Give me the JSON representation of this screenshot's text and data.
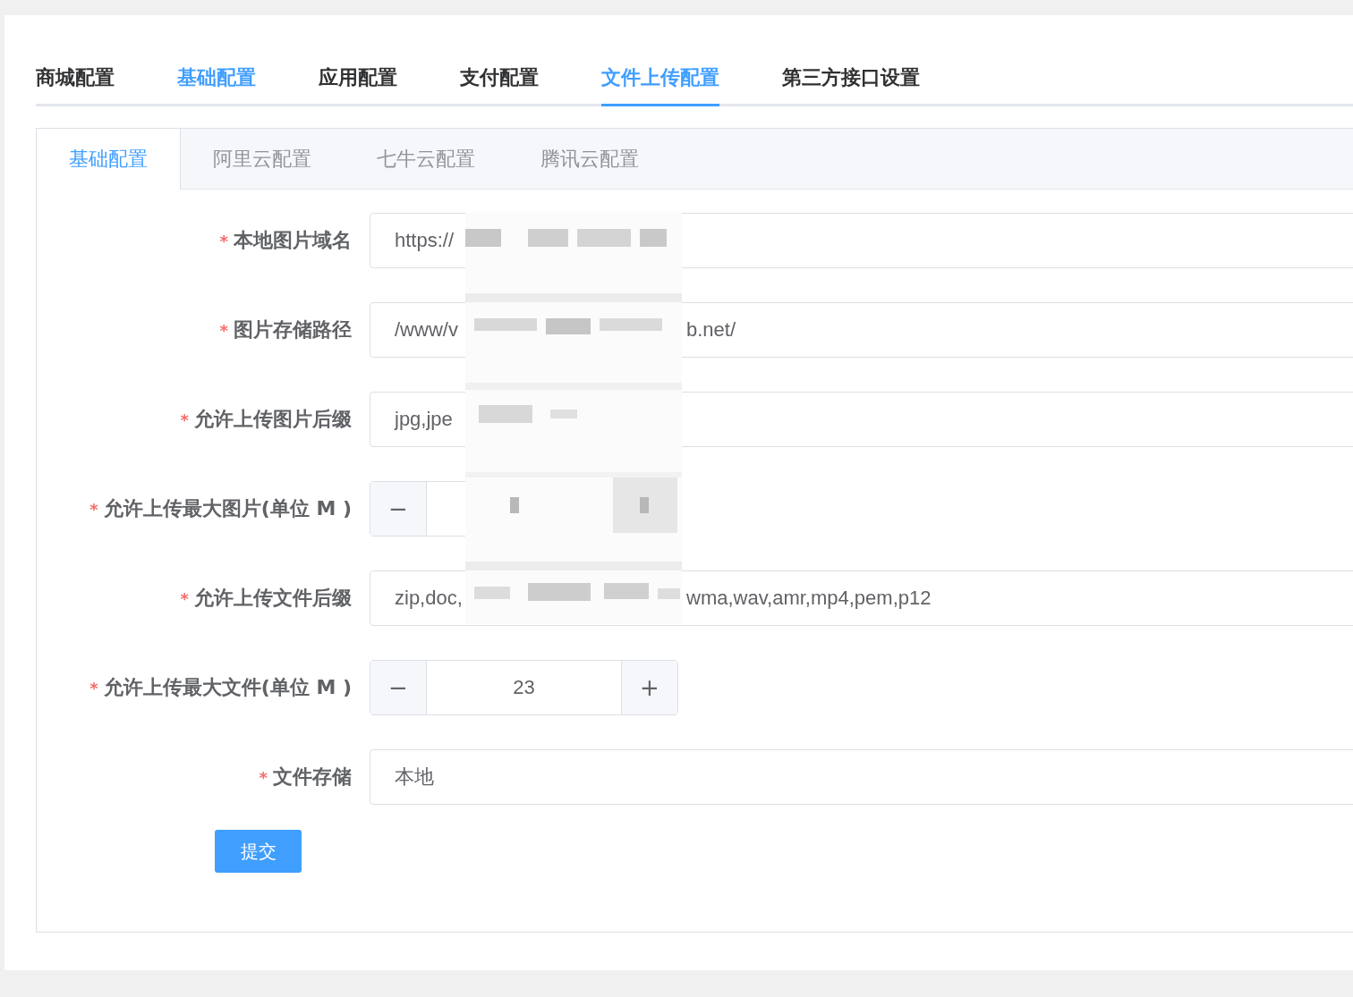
{
  "tabs": [
    {
      "label": "商城配置",
      "selected": false,
      "hover": false
    },
    {
      "label": "基础配置",
      "selected": false,
      "hover": true
    },
    {
      "label": "应用配置",
      "selected": false,
      "hover": false
    },
    {
      "label": "支付配置",
      "selected": false,
      "hover": false
    },
    {
      "label": "文件上传配置",
      "selected": true,
      "hover": false
    },
    {
      "label": "第三方接口设置",
      "selected": false,
      "hover": false
    }
  ],
  "sub_tabs": [
    {
      "label": "基础配置",
      "selected": true
    },
    {
      "label": "阿里云配置",
      "selected": false
    },
    {
      "label": "七牛云配置",
      "selected": false
    },
    {
      "label": "腾讯云配置",
      "selected": false
    }
  ],
  "form": {
    "fields": [
      {
        "kind": "text",
        "label": "本地图片域名",
        "required": true,
        "value": "https://"
      },
      {
        "kind": "text",
        "label": "图片存储路径",
        "required": true,
        "value": "/www/v",
        "value_tail": "b.net/"
      },
      {
        "kind": "text",
        "label": "允许上传图片后缀",
        "required": true,
        "value": "jpg,jpe"
      },
      {
        "kind": "stepper",
        "label": "允许上传最大图片(单位 M )",
        "required": true,
        "minus": "−"
      },
      {
        "kind": "text",
        "label": "允许上传文件后缀",
        "required": true,
        "value": "zip,doc,",
        "value_tail": "wma,wav,amr,mp4,pem,p12"
      },
      {
        "kind": "stepper",
        "label": "允许上传最大文件(单位 M )",
        "required": true,
        "minus": "−",
        "value": "23",
        "plus": "+"
      },
      {
        "kind": "text",
        "label": "文件存储",
        "required": true,
        "value": "本地"
      }
    ],
    "required_mark": "*",
    "submit": "提交"
  },
  "redacted_area": true
}
